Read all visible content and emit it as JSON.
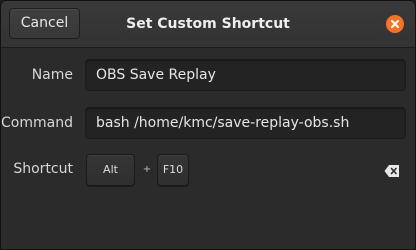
{
  "dialog": {
    "title": "Set Custom Shortcut",
    "cancel_label": "Cancel",
    "close_icon": "close-icon",
    "accent_color": "#f37329"
  },
  "form": {
    "name_label": "Name",
    "name_value": "OBS Save Replay",
    "command_label": "Command",
    "command_value": "bash /home/kmc/save-replay-obs.sh",
    "shortcut_label": "Shortcut",
    "shortcut_keys": [
      "Alt",
      "F10"
    ],
    "separator": "+",
    "clear_icon": "backspace-clear-icon"
  }
}
